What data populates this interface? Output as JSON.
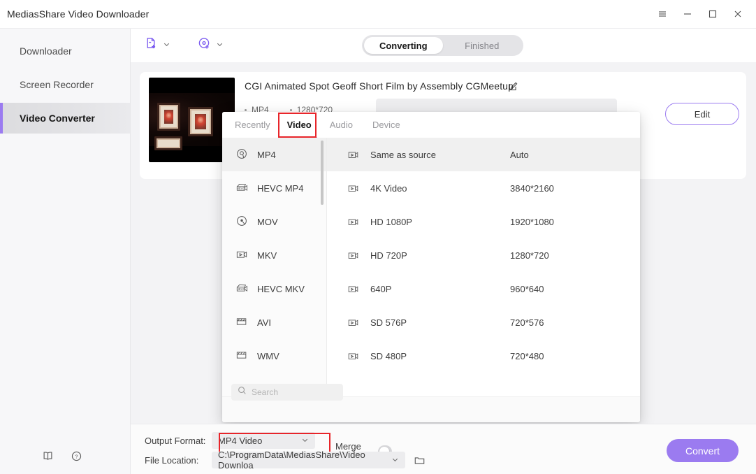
{
  "window": {
    "title": "MediasShare Video Downloader",
    "controls": [
      {
        "name": "menu-icon",
        "glyph": "menu"
      },
      {
        "name": "minimize-icon",
        "glyph": "minimize"
      },
      {
        "name": "maximize-icon",
        "glyph": "maximize"
      },
      {
        "name": "close-icon",
        "glyph": "close"
      }
    ]
  },
  "sidebar": {
    "items": [
      {
        "label": "Downloader",
        "active": false
      },
      {
        "label": "Screen Recorder",
        "active": false
      },
      {
        "label": "Video Converter",
        "active": true
      }
    ],
    "bottom_icons": [
      {
        "name": "book-icon"
      },
      {
        "name": "help-icon"
      }
    ]
  },
  "toolbar": {
    "add_file_icon": "add-file-icon",
    "add_disc_icon": "add-disc-icon",
    "tabs": [
      {
        "label": "Converting",
        "active": true
      },
      {
        "label": "Finished",
        "active": false
      }
    ]
  },
  "card": {
    "title": "CGI Animated Spot Geoff Short Film by Assembly  CGMeetup",
    "edit_title_icon": "edit-pencil-icon",
    "meta": [
      "MP4",
      "1280*720"
    ],
    "edit_button": "Edit"
  },
  "panel": {
    "tabs": [
      {
        "label": "Recently",
        "active": false
      },
      {
        "label": "Video",
        "active": true,
        "highlighted": true
      },
      {
        "label": "Audio",
        "active": false
      },
      {
        "label": "Device",
        "active": false
      }
    ],
    "formats": [
      {
        "label": "MP4",
        "icon": "disc-icon",
        "selected": true
      },
      {
        "label": "HEVC MP4",
        "icon": "hevc-icon",
        "selected": false
      },
      {
        "label": "MOV",
        "icon": "disc-dot-icon",
        "selected": false
      },
      {
        "label": "MKV",
        "icon": "camera-icon",
        "selected": false
      },
      {
        "label": "HEVC MKV",
        "icon": "hevc-icon",
        "selected": false
      },
      {
        "label": "AVI",
        "icon": "clapper-icon",
        "selected": false
      },
      {
        "label": "WMV",
        "icon": "clapper-icon",
        "selected": false
      }
    ],
    "resolutions": [
      {
        "name": "Same as source",
        "dimension": "Auto",
        "selected": true
      },
      {
        "name": "4K Video",
        "dimension": "3840*2160",
        "selected": false
      },
      {
        "name": "HD 1080P",
        "dimension": "1920*1080",
        "selected": false
      },
      {
        "name": "HD 720P",
        "dimension": "1280*720",
        "selected": false
      },
      {
        "name": "640P",
        "dimension": "960*640",
        "selected": false
      },
      {
        "name": "SD 576P",
        "dimension": "720*576",
        "selected": false
      },
      {
        "name": "SD 480P",
        "dimension": "720*480",
        "selected": false
      }
    ],
    "search": {
      "value": "",
      "placeholder": "Search",
      "icon": "search-icon"
    }
  },
  "bottom": {
    "output_format_label": "Output Format:",
    "output_format_value": "MP4 Video",
    "file_location_label": "File Location:",
    "file_location_value": "C:\\ProgramData\\MediasShare\\Video Downloa",
    "merge_label": "Merge All Files:",
    "merge_on": false,
    "folder_icon": "folder-icon",
    "convert_button": "Convert"
  },
  "colors": {
    "accent": "#9b7bf0",
    "highlight_red": "#e8252a",
    "panel_bg": "#ffffff",
    "app_bg": "#f3f3f5"
  }
}
